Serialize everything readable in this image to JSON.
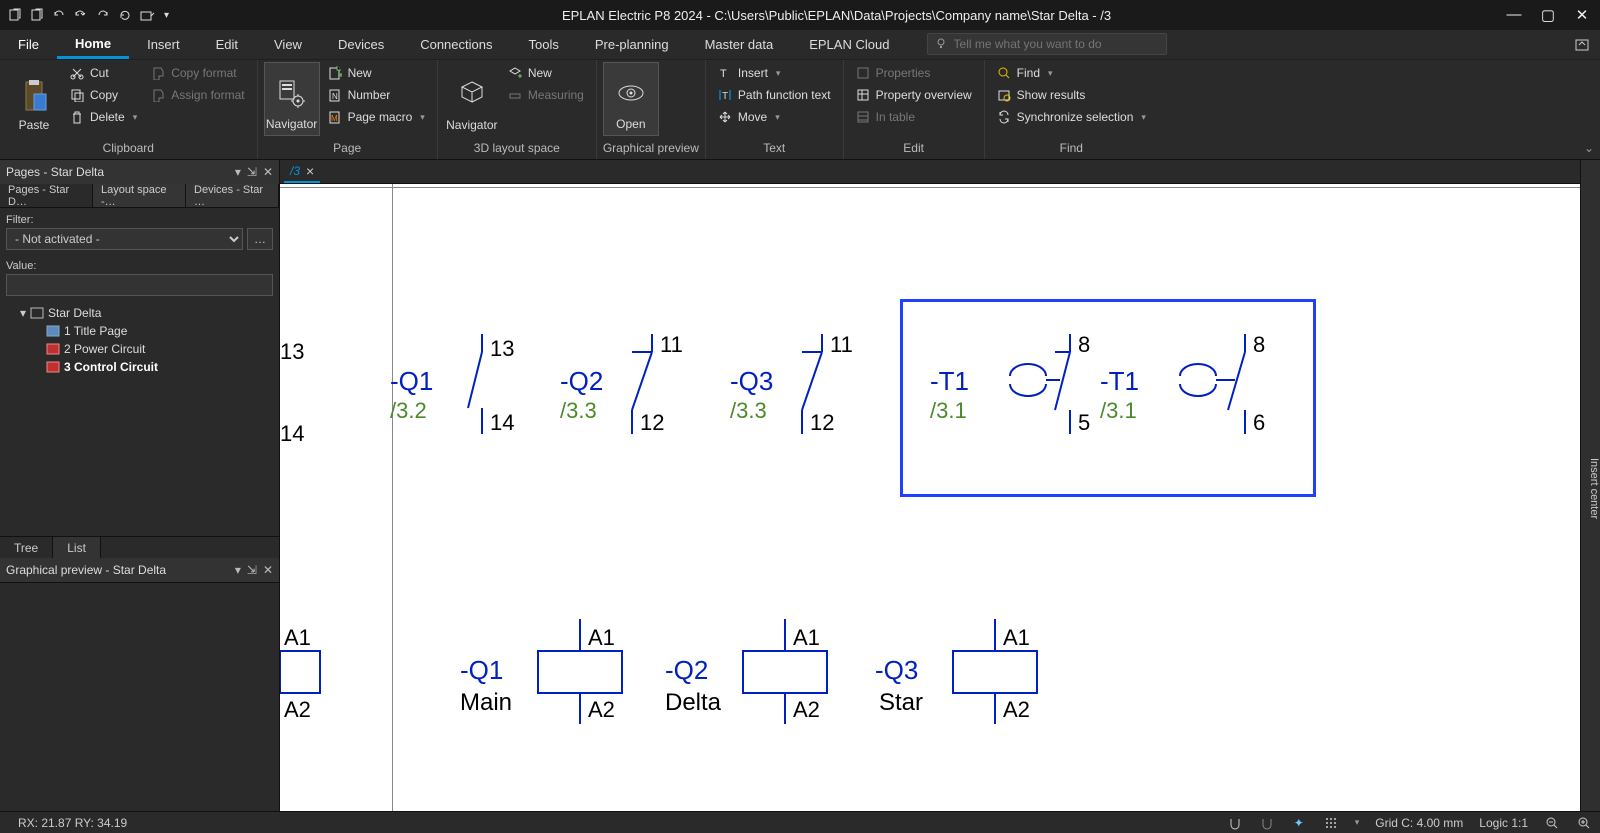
{
  "titlebar": {
    "title": "EPLAN Electric P8 2024 - C:\\Users\\Public\\EPLAN\\Data\\Projects\\Company name\\Star Delta - /3"
  },
  "menu": {
    "tabs": [
      "File",
      "Home",
      "Insert",
      "Edit",
      "View",
      "Devices",
      "Connections",
      "Tools",
      "Pre-planning",
      "Master data",
      "EPLAN Cloud"
    ],
    "active": 1,
    "search_placeholder": "Tell me what you want to do"
  },
  "ribbon": {
    "clipboard": {
      "paste": "Paste",
      "cut": "Cut",
      "copy": "Copy",
      "delete": "Delete",
      "copyformat": "Copy format",
      "assignformat": "Assign format",
      "label": "Clipboard"
    },
    "page": {
      "navigator": "Navigator",
      "new": "New",
      "number": "Number",
      "macro": "Page macro",
      "label": "Page"
    },
    "layout": {
      "navigator": "Navigator",
      "new": "New",
      "measuring": "Measuring",
      "label": "3D layout space"
    },
    "preview": {
      "open": "Open",
      "label": "Graphical preview"
    },
    "text": {
      "insert": "Insert",
      "pathfn": "Path function text",
      "move": "Move",
      "label": "Text"
    },
    "edit": {
      "properties": "Properties",
      "overview": "Property overview",
      "intable": "In table",
      "label": "Edit"
    },
    "find": {
      "find": "Find",
      "results": "Show results",
      "sync": "Synchronize selection",
      "label": "Find"
    }
  },
  "pages_panel": {
    "title": "Pages - Star Delta",
    "tabs": [
      "Pages - Star D…",
      "Layout space -…",
      "Devices - Star …"
    ],
    "filter_label": "Filter:",
    "filter_value": "- Not activated -",
    "value_label": "Value:",
    "tree": {
      "root": "Star Delta",
      "items": [
        "1 Title Page",
        "2 Power Circuit",
        "3 Control Circuit"
      ]
    },
    "bottom_tabs": [
      "Tree",
      "List"
    ]
  },
  "preview_panel": {
    "title": "Graphical preview - Star Delta"
  },
  "doc": {
    "tab": "/3"
  },
  "schematic": {
    "edge": {
      "t13": "13",
      "t14": "14",
      "a1": "A1",
      "a2": "A2"
    },
    "q1": {
      "dt": "-Q1",
      "cr": "/3.2",
      "p1": "13",
      "p2": "14"
    },
    "q2": {
      "dt": "-Q2",
      "cr": "/3.3",
      "p1": "11",
      "p2": "12"
    },
    "q3": {
      "dt": "-Q3",
      "cr": "/3.3",
      "p1": "11",
      "p2": "12"
    },
    "t1a": {
      "dt": "-T1",
      "cr": "/3.1",
      "p1": "8",
      "p2": "5"
    },
    "t1b": {
      "dt": "-T1",
      "cr": "/3.1",
      "p1": "8",
      "p2": "6"
    },
    "coil_q1": {
      "dt": "-Q1",
      "sub": "Main",
      "p1": "A1",
      "p2": "A2"
    },
    "coil_q2": {
      "dt": "-Q2",
      "sub": "Delta",
      "p1": "A1",
      "p2": "A2"
    },
    "coil_q3": {
      "dt": "-Q3",
      "sub": "Star",
      "p1": "A1",
      "p2": "A2"
    }
  },
  "rightstrip": {
    "label": "Insert center"
  },
  "statusbar": {
    "coords": "RX: 21.87 RY: 34.19",
    "grid": "Grid C: 4.00 mm",
    "logic": "Logic 1:1"
  }
}
